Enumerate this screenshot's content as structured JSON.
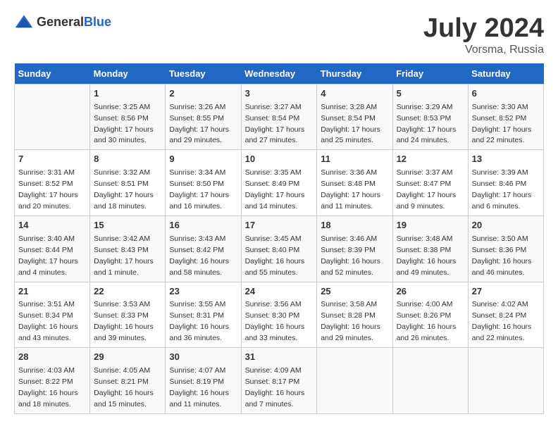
{
  "header": {
    "logo_general": "General",
    "logo_blue": "Blue",
    "month_year": "July 2024",
    "location": "Vorsma, Russia"
  },
  "days_of_week": [
    "Sunday",
    "Monday",
    "Tuesday",
    "Wednesday",
    "Thursday",
    "Friday",
    "Saturday"
  ],
  "weeks": [
    [
      {
        "day": "",
        "info": ""
      },
      {
        "day": "1",
        "info": "Sunrise: 3:25 AM\nSunset: 8:56 PM\nDaylight: 17 hours\nand 30 minutes."
      },
      {
        "day": "2",
        "info": "Sunrise: 3:26 AM\nSunset: 8:55 PM\nDaylight: 17 hours\nand 29 minutes."
      },
      {
        "day": "3",
        "info": "Sunrise: 3:27 AM\nSunset: 8:54 PM\nDaylight: 17 hours\nand 27 minutes."
      },
      {
        "day": "4",
        "info": "Sunrise: 3:28 AM\nSunset: 8:54 PM\nDaylight: 17 hours\nand 25 minutes."
      },
      {
        "day": "5",
        "info": "Sunrise: 3:29 AM\nSunset: 8:53 PM\nDaylight: 17 hours\nand 24 minutes."
      },
      {
        "day": "6",
        "info": "Sunrise: 3:30 AM\nSunset: 8:52 PM\nDaylight: 17 hours\nand 22 minutes."
      }
    ],
    [
      {
        "day": "7",
        "info": "Sunrise: 3:31 AM\nSunset: 8:52 PM\nDaylight: 17 hours\nand 20 minutes."
      },
      {
        "day": "8",
        "info": "Sunrise: 3:32 AM\nSunset: 8:51 PM\nDaylight: 17 hours\nand 18 minutes."
      },
      {
        "day": "9",
        "info": "Sunrise: 3:34 AM\nSunset: 8:50 PM\nDaylight: 17 hours\nand 16 minutes."
      },
      {
        "day": "10",
        "info": "Sunrise: 3:35 AM\nSunset: 8:49 PM\nDaylight: 17 hours\nand 14 minutes."
      },
      {
        "day": "11",
        "info": "Sunrise: 3:36 AM\nSunset: 8:48 PM\nDaylight: 17 hours\nand 11 minutes."
      },
      {
        "day": "12",
        "info": "Sunrise: 3:37 AM\nSunset: 8:47 PM\nDaylight: 17 hours\nand 9 minutes."
      },
      {
        "day": "13",
        "info": "Sunrise: 3:39 AM\nSunset: 8:46 PM\nDaylight: 17 hours\nand 6 minutes."
      }
    ],
    [
      {
        "day": "14",
        "info": "Sunrise: 3:40 AM\nSunset: 8:44 PM\nDaylight: 17 hours\nand 4 minutes."
      },
      {
        "day": "15",
        "info": "Sunrise: 3:42 AM\nSunset: 8:43 PM\nDaylight: 17 hours\nand 1 minute."
      },
      {
        "day": "16",
        "info": "Sunrise: 3:43 AM\nSunset: 8:42 PM\nDaylight: 16 hours\nand 58 minutes."
      },
      {
        "day": "17",
        "info": "Sunrise: 3:45 AM\nSunset: 8:40 PM\nDaylight: 16 hours\nand 55 minutes."
      },
      {
        "day": "18",
        "info": "Sunrise: 3:46 AM\nSunset: 8:39 PM\nDaylight: 16 hours\nand 52 minutes."
      },
      {
        "day": "19",
        "info": "Sunrise: 3:48 AM\nSunset: 8:38 PM\nDaylight: 16 hours\nand 49 minutes."
      },
      {
        "day": "20",
        "info": "Sunrise: 3:50 AM\nSunset: 8:36 PM\nDaylight: 16 hours\nand 46 minutes."
      }
    ],
    [
      {
        "day": "21",
        "info": "Sunrise: 3:51 AM\nSunset: 8:34 PM\nDaylight: 16 hours\nand 43 minutes."
      },
      {
        "day": "22",
        "info": "Sunrise: 3:53 AM\nSunset: 8:33 PM\nDaylight: 16 hours\nand 39 minutes."
      },
      {
        "day": "23",
        "info": "Sunrise: 3:55 AM\nSunset: 8:31 PM\nDaylight: 16 hours\nand 36 minutes."
      },
      {
        "day": "24",
        "info": "Sunrise: 3:56 AM\nSunset: 8:30 PM\nDaylight: 16 hours\nand 33 minutes."
      },
      {
        "day": "25",
        "info": "Sunrise: 3:58 AM\nSunset: 8:28 PM\nDaylight: 16 hours\nand 29 minutes."
      },
      {
        "day": "26",
        "info": "Sunrise: 4:00 AM\nSunset: 8:26 PM\nDaylight: 16 hours\nand 26 minutes."
      },
      {
        "day": "27",
        "info": "Sunrise: 4:02 AM\nSunset: 8:24 PM\nDaylight: 16 hours\nand 22 minutes."
      }
    ],
    [
      {
        "day": "28",
        "info": "Sunrise: 4:03 AM\nSunset: 8:22 PM\nDaylight: 16 hours\nand 18 minutes."
      },
      {
        "day": "29",
        "info": "Sunrise: 4:05 AM\nSunset: 8:21 PM\nDaylight: 16 hours\nand 15 minutes."
      },
      {
        "day": "30",
        "info": "Sunrise: 4:07 AM\nSunset: 8:19 PM\nDaylight: 16 hours\nand 11 minutes."
      },
      {
        "day": "31",
        "info": "Sunrise: 4:09 AM\nSunset: 8:17 PM\nDaylight: 16 hours\nand 7 minutes."
      },
      {
        "day": "",
        "info": ""
      },
      {
        "day": "",
        "info": ""
      },
      {
        "day": "",
        "info": ""
      }
    ]
  ]
}
